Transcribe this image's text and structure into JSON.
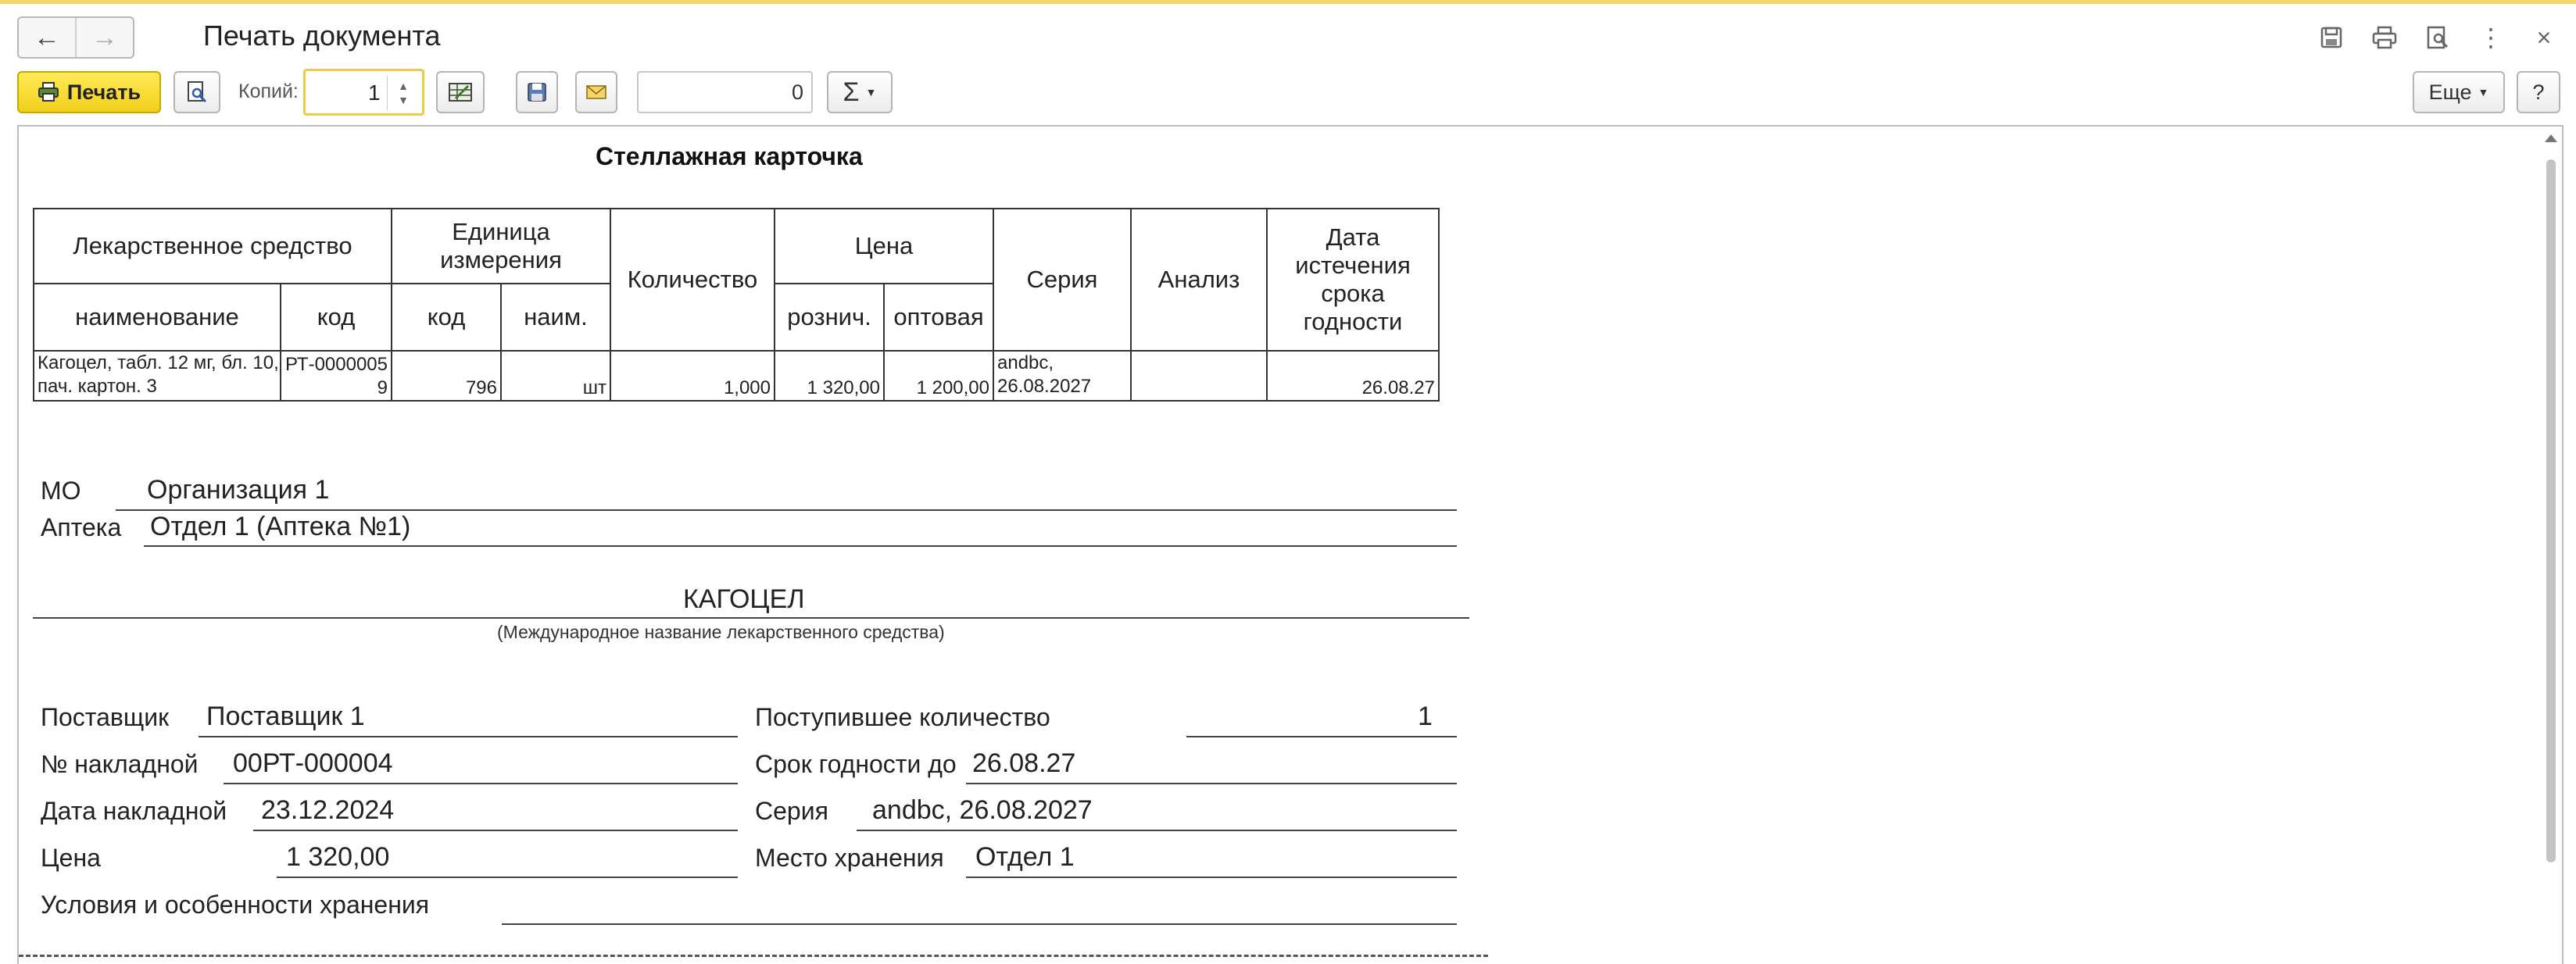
{
  "window": {
    "title": "Печать документа",
    "nav_back": "←",
    "nav_forward": "→",
    "icons": [
      "save-icon",
      "print-icon",
      "preview-icon",
      "more-vertical-icon",
      "close-icon"
    ],
    "close_glyph": "×",
    "more_glyph": "⋮"
  },
  "toolbar": {
    "print_label": "Печать",
    "copies_label": "Копий:",
    "copies_value": "1",
    "sum_value": "0",
    "sigma_glyph": "Σ",
    "more_label": "Еще",
    "help_label": "?"
  },
  "document": {
    "title": "Стеллажная карточка",
    "table": {
      "headers": {
        "drug": "Лекарственное средство",
        "unit": "Единица измерения",
        "qty": "Количество",
        "price": "Цена",
        "series": "Серия",
        "analysis": "Анализ",
        "expiry": "Дата истечения срока годности",
        "name": "наименование",
        "code": "код",
        "unit_code": "код",
        "unit_name": "наим.",
        "retail": "рознич.",
        "wholesale": "оптовая"
      },
      "row": {
        "name": "Кагоцел, табл. 12 мг, бл. 10, пач. картон. 3",
        "code": "РТ-00000059",
        "unit_code": "796",
        "unit_name": "шт",
        "qty": "1,000",
        "retail": "1 320,00",
        "wholesale": "1 200,00",
        "series": "andbc, 26.08.2027",
        "analysis": "",
        "expiry": "26.08.27"
      }
    },
    "mo_label": "МО",
    "mo_value": "Организация 1",
    "pharmacy_label": "Аптека",
    "pharmacy_value": "Отдел 1 (Аптека №1)",
    "intl_name": "КАГОЦЕЛ",
    "intl_name_caption": "(Международное название лекарственного средства)",
    "supplier_label": "Поставщик",
    "supplier_value": "Поставщик 1",
    "invoice_no_label": "№ накладной",
    "invoice_no_value": "00РТ-000004",
    "invoice_date_label": "Дата накладной",
    "invoice_date_value": "23.12.2024",
    "price_label": "Цена",
    "price_value": "1 320,00",
    "received_qty_label": "Поступившее количество",
    "received_qty_value": "1",
    "expiry_label": "Срок годности до",
    "expiry_value": "26.08.27",
    "series_label": "Серия",
    "series_value": "andbc, 26.08.2027",
    "storage_place_label": "Место хранения",
    "storage_place_value": "Отдел 1",
    "storage_conditions_label": "Условия и особенности хранения",
    "storage_conditions_value": ""
  },
  "colors": {
    "print_button": "#f5d32a",
    "copies_border": "#f0c84a",
    "top_accent": "#f5d66b"
  }
}
